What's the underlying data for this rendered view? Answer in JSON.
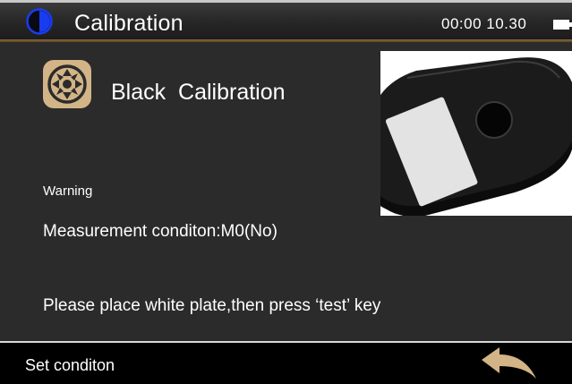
{
  "header": {
    "title": "Calibration",
    "clock": "00:00 10.30",
    "app_icon": "half-circle-logo-icon",
    "battery_icon": "battery-icon"
  },
  "main": {
    "heading": "Black  Calibration",
    "heading_icon": "calibration-wheel-icon",
    "photo": "black-calibration-cavity-image",
    "warning": "Warning",
    "condition": "Measurement conditon:M0(No)",
    "instruction": "Please place white plate,then press ‘test’ key"
  },
  "footer": {
    "set_condition_label": "Set conditon",
    "back_icon": "back-arrow-icon"
  },
  "colors": {
    "background": "#2b2b2b",
    "footer": "#000000",
    "accent_gold": "#d3b487",
    "logo_blue": "#1a3cf0",
    "text": "#ffffff"
  }
}
